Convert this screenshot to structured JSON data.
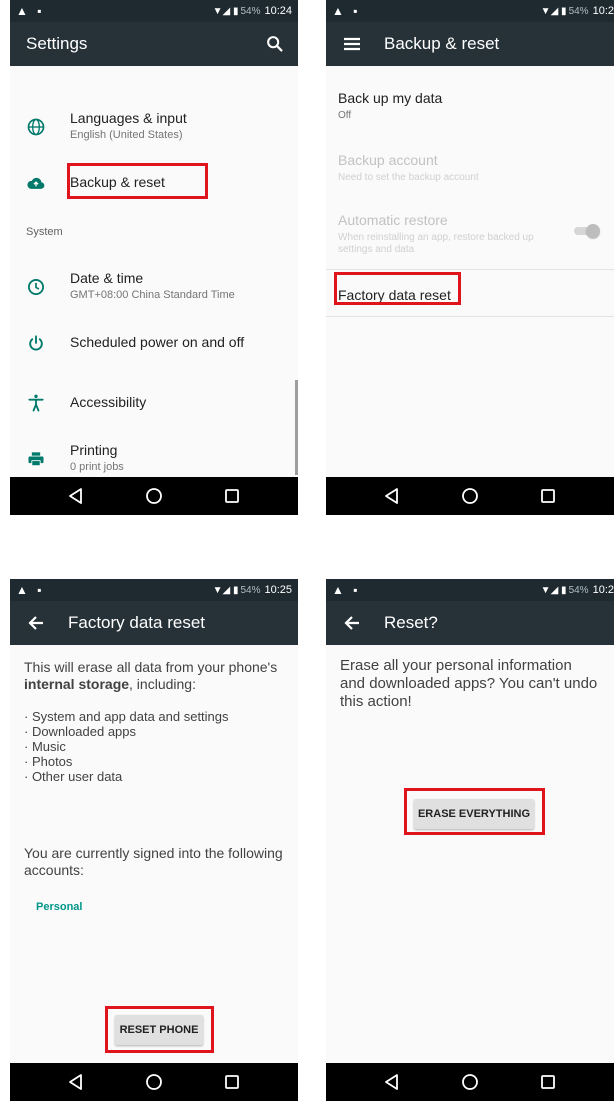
{
  "status_bar": {
    "left_icons": "▲ ▪",
    "battery_pct": "54%",
    "times": [
      "10:24",
      "10:2",
      "10:25",
      "10:2"
    ]
  },
  "screen1": {
    "title": "Settings",
    "items": [
      {
        "title": "Languages & input",
        "subtitle": "English (United States)",
        "icon": "globe-icon"
      },
      {
        "title": "Backup & reset",
        "icon": "cloud-upload-icon"
      }
    ],
    "section": "System",
    "system_items": [
      {
        "title": "Date & time",
        "subtitle": "GMT+08:00 China Standard Time",
        "icon": "clock-icon"
      },
      {
        "title": "Scheduled power on and off",
        "icon": "power-icon"
      },
      {
        "title": "Accessibility",
        "icon": "accessibility-icon"
      },
      {
        "title": "Printing",
        "subtitle": "0 print jobs",
        "icon": "printer-icon"
      }
    ]
  },
  "screen2": {
    "title": "Backup & reset",
    "items": [
      {
        "title": "Back up my data",
        "subtitle": "Off",
        "enabled": true
      },
      {
        "title": "Backup account",
        "subtitle": "Need to set the backup account",
        "enabled": false
      },
      {
        "title": "Automatic restore",
        "subtitle": "When reinstalling an app, restore backed up settings and data",
        "enabled": false,
        "toggle": "on"
      },
      {
        "title": "Factory data reset",
        "enabled": true
      }
    ]
  },
  "screen3": {
    "title": "Factory data reset",
    "intro_prefix": "This will erase all data from your phone's",
    "intro_bold": "internal storage",
    "intro_suffix": ", including:",
    "bullets": [
      "· System and app data and settings",
      "· Downloaded apps",
      "· Music",
      "· Photos",
      "· Other user data"
    ],
    "accounts_text": "You are currently signed into the following accounts:",
    "account": "Personal",
    "button": "RESET PHONE"
  },
  "screen4": {
    "title": "Reset?",
    "message": "Erase all your personal information and downloaded apps? You can't undo this action!",
    "button": "ERASE EVERYTHING"
  },
  "colors": {
    "status_bar": "#1e2a30",
    "app_bar": "#263238",
    "nav_bar": "#000000",
    "accent": "#009688",
    "highlight": "#e0141c",
    "icon_teal": "#00796b"
  },
  "nav_icons": [
    "back-triangle-icon",
    "home-circle-icon",
    "recents-square-icon"
  ]
}
